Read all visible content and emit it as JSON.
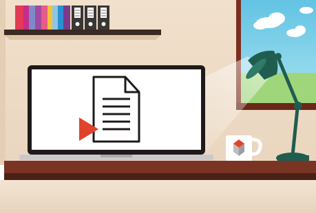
{
  "scene": {
    "wall_color": "#efdcc6",
    "shelf_color": "#3a2a22",
    "desk_color": "#7a3424",
    "desk_shadow_color": "#4a2117",
    "floor_color": "#e9d7c3",
    "window_frame_color": "#7b2f1f",
    "sky_color": "#7fd1e8",
    "laptop_screen_color": "#ffffff",
    "laptop_bezel_color": "#1e1a1a",
    "play_color": "#e0432b",
    "lamp_color": "#1f5d4f",
    "mug_color": "#ffffff",
    "icons": [
      "books",
      "binders",
      "window",
      "clouds",
      "laptop",
      "document-icon",
      "play-icon",
      "coffee-mug",
      "desk-lamp"
    ]
  }
}
